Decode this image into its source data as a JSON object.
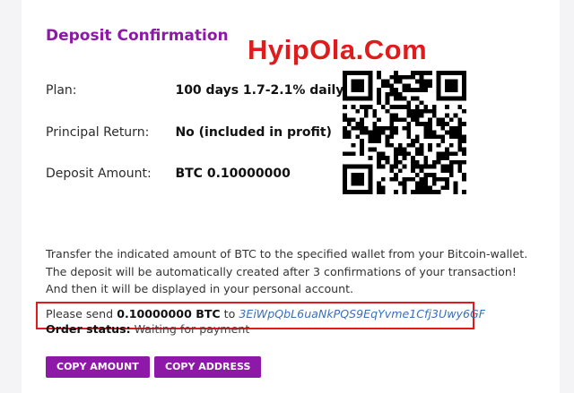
{
  "header": {
    "title": "Deposit Confirmation",
    "watermark": "HyipOla.Com"
  },
  "details": {
    "plan_label": "Plan:",
    "plan_value": "100 days 1.7-2.1% daily",
    "return_label": "Principal Return:",
    "return_value": "No (included in profit)",
    "amount_label": "Deposit Amount:",
    "amount_value": "BTC 0.10000000"
  },
  "instructions": {
    "line1": "Transfer the indicated amount of BTC to the specified wallet from your Bitcoin-wallet.",
    "line2": "The deposit will be automatically created after 3 confirmations of your transaction!",
    "line3": "And then it will be displayed in your personal account."
  },
  "payment": {
    "prefix": "Please send",
    "amount": "0.10000000 BTC",
    "to": "to",
    "address": "3EiWpQbL6uaNkPQS9EqYvme1Cfj3Uwy6GF",
    "status_label": "Order status:",
    "status_value": "Waiting for payment"
  },
  "buttons": {
    "copy_amount": "COPY AMOUNT",
    "copy_address": "COPY ADDRESS"
  },
  "colors": {
    "accent": "#8e18a8",
    "highlight": "#e01b1b",
    "link": "#3b6fb6"
  },
  "icons": {
    "qr": "qr-code-icon"
  }
}
